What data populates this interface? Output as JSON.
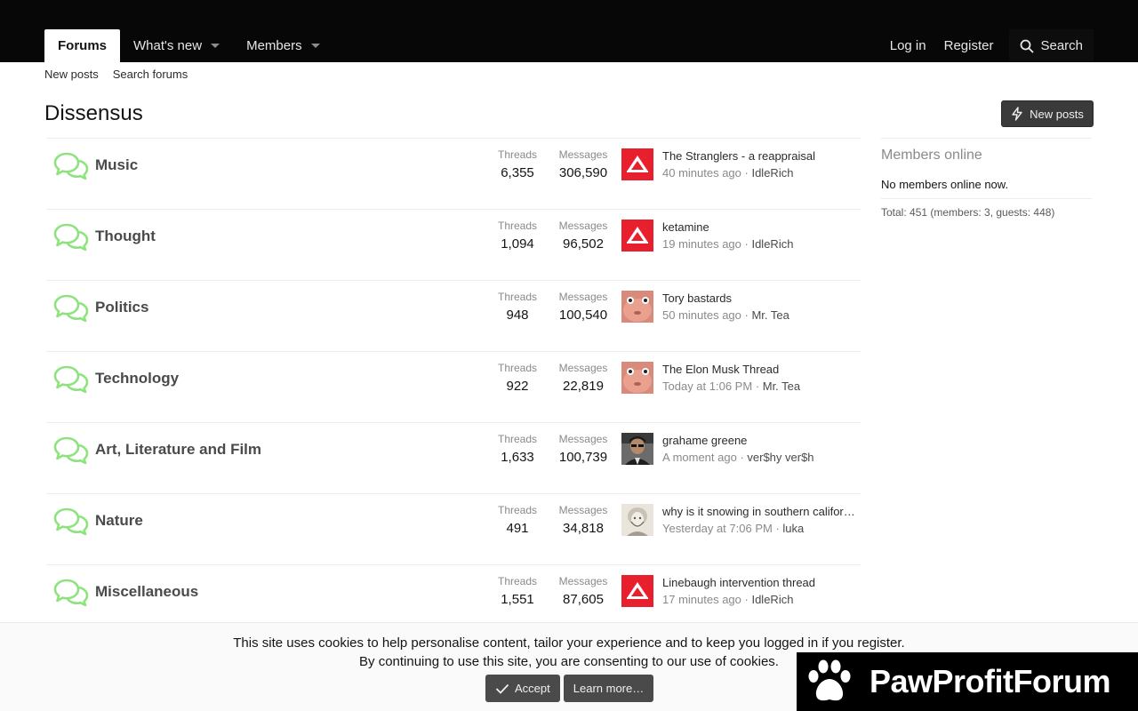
{
  "header": {
    "tabs": [
      {
        "label": "Forums"
      },
      {
        "label": "What's new"
      },
      {
        "label": "Members"
      }
    ],
    "login_label": "Log in",
    "register_label": "Register",
    "search_label": "Search"
  },
  "subnav": {
    "new_posts": "New posts",
    "search_forums": "Search forums"
  },
  "page_title": "Dissensus",
  "new_posts_button": "New posts",
  "forum_columns": {
    "threads": "Threads",
    "messages": "Messages"
  },
  "forums": [
    {
      "title": "Music",
      "threads": "6,355",
      "messages": "306,590",
      "latest_thread": "The Stranglers - a reappraisal",
      "latest_time": "40 minutes ago",
      "latest_user": "IdleRich",
      "avatar": "red-triangle"
    },
    {
      "title": "Thought",
      "threads": "1,094",
      "messages": "96,502",
      "latest_thread": "ketamine",
      "latest_time": "19 minutes ago",
      "latest_user": "IdleRich",
      "avatar": "red-triangle"
    },
    {
      "title": "Politics",
      "threads": "948",
      "messages": "100,540",
      "latest_thread": "Tory bastards",
      "latest_time": "50 minutes ago",
      "latest_user": "Mr. Tea",
      "avatar": "pink-face"
    },
    {
      "title": "Technology",
      "threads": "922",
      "messages": "22,819",
      "latest_thread": "The Elon Musk Thread",
      "latest_time": "Today at 1:06 PM",
      "latest_user": "Mr. Tea",
      "avatar": "pink-face"
    },
    {
      "title": "Art, Literature and Film",
      "threads": "1,633",
      "messages": "100,739",
      "latest_thread": "grahame greene",
      "latest_time": "A moment ago",
      "latest_user": "ver$hy ver$h",
      "avatar": "photo-man"
    },
    {
      "title": "Nature",
      "threads": "491",
      "messages": "34,818",
      "latest_thread": "why is it snowing in southern california",
      "latest_time": "Yesterday at 7:06 PM",
      "latest_user": "luka",
      "avatar": "sketch-portrait"
    },
    {
      "title": "Miscellaneous",
      "threads": "1,551",
      "messages": "87,605",
      "latest_thread": "Linebaugh intervention thread",
      "latest_time": "17 minutes ago",
      "latest_user": "IdleRich",
      "avatar": "red-triangle"
    }
  ],
  "sidebar": {
    "title": "Members online",
    "status": "No members online now.",
    "total": "Total: 451 (members: 3, guests: 448)"
  },
  "cookie": {
    "line1": "This site uses cookies to help personalise content, tailor your experience and to keep you logged in if you register.",
    "line2": "By continuing to use this site, you are consenting to our use of cookies.",
    "accept": "Accept",
    "learn_more": "Learn more…"
  },
  "watermark": {
    "text": "PawProfitForum"
  },
  "colors": {
    "forum_icon": "#8fe37f",
    "topbar": "#070707",
    "button": "#3a3a3a",
    "avatar_red": "#e8202e"
  }
}
